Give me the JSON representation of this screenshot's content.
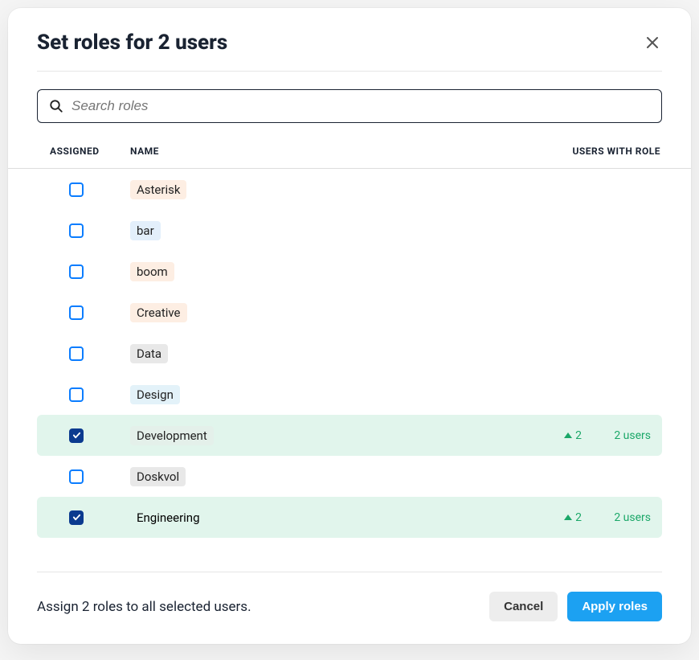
{
  "header": {
    "title": "Set roles for 2 users"
  },
  "search": {
    "placeholder": "Search roles"
  },
  "table": {
    "columns": {
      "assigned": "ASSIGNED",
      "name": "NAME",
      "users_with_role": "USERS WITH ROLE"
    },
    "rows": [
      {
        "checked": false,
        "name": "Asterisk",
        "tag_color": "orange",
        "delta": "",
        "users": ""
      },
      {
        "checked": false,
        "name": "bar",
        "tag_color": "blue",
        "delta": "",
        "users": ""
      },
      {
        "checked": false,
        "name": "boom",
        "tag_color": "orange",
        "delta": "",
        "users": ""
      },
      {
        "checked": false,
        "name": "Creative",
        "tag_color": "orange",
        "delta": "",
        "users": ""
      },
      {
        "checked": false,
        "name": "Data",
        "tag_color": "gray",
        "delta": "",
        "users": ""
      },
      {
        "checked": false,
        "name": "Design",
        "tag_color": "lblue",
        "delta": "",
        "users": ""
      },
      {
        "checked": true,
        "name": "Development",
        "tag_color": "green",
        "delta": "2",
        "users": "2 users"
      },
      {
        "checked": false,
        "name": "Doskvol",
        "tag_color": "gray",
        "delta": "",
        "users": ""
      },
      {
        "checked": true,
        "name": "Engineering",
        "tag_color": "none",
        "delta": "2",
        "users": "2 users"
      }
    ]
  },
  "footer": {
    "summary": "Assign 2 roles to all selected users.",
    "cancel": "Cancel",
    "apply": "Apply roles"
  }
}
